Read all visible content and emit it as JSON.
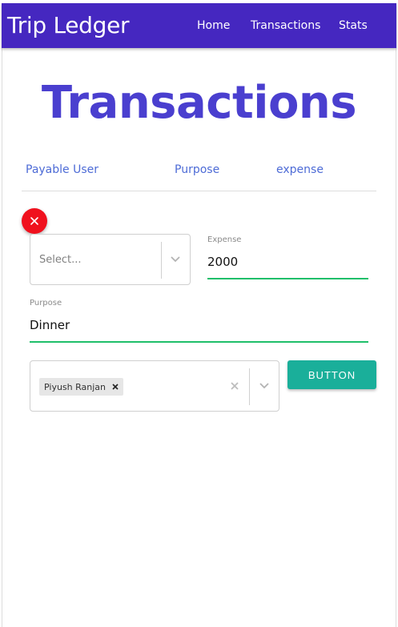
{
  "navbar": {
    "brand": "Trip Ledger",
    "links": [
      "Home",
      "Transactions",
      "Stats"
    ],
    "background_color": "#4527c0"
  },
  "page": {
    "title": "Transactions",
    "title_color": "#4a3fcf"
  },
  "table_headers": [
    "Payable User",
    "Purpose",
    "expense"
  ],
  "transaction_form": {
    "remove_icon": "close-icon",
    "user_select": {
      "placeholder": "Select...",
      "icon": "chevron-down-icon"
    },
    "expense": {
      "label": "Expense",
      "value": "2000"
    },
    "purpose": {
      "label": "Purpose",
      "value": "Dinner"
    },
    "participants": {
      "selected": [
        "Piyush Ranjan"
      ],
      "clear_icon": "clear-icon",
      "dropdown_icon": "chevron-down-icon"
    },
    "submit_button": {
      "label": "BUTTON",
      "color": "#1aaf9a"
    }
  },
  "colors": {
    "remove_button": "#f0111e",
    "field_underline": "#1fbf6a",
    "header_text": "#4d6bd6"
  }
}
